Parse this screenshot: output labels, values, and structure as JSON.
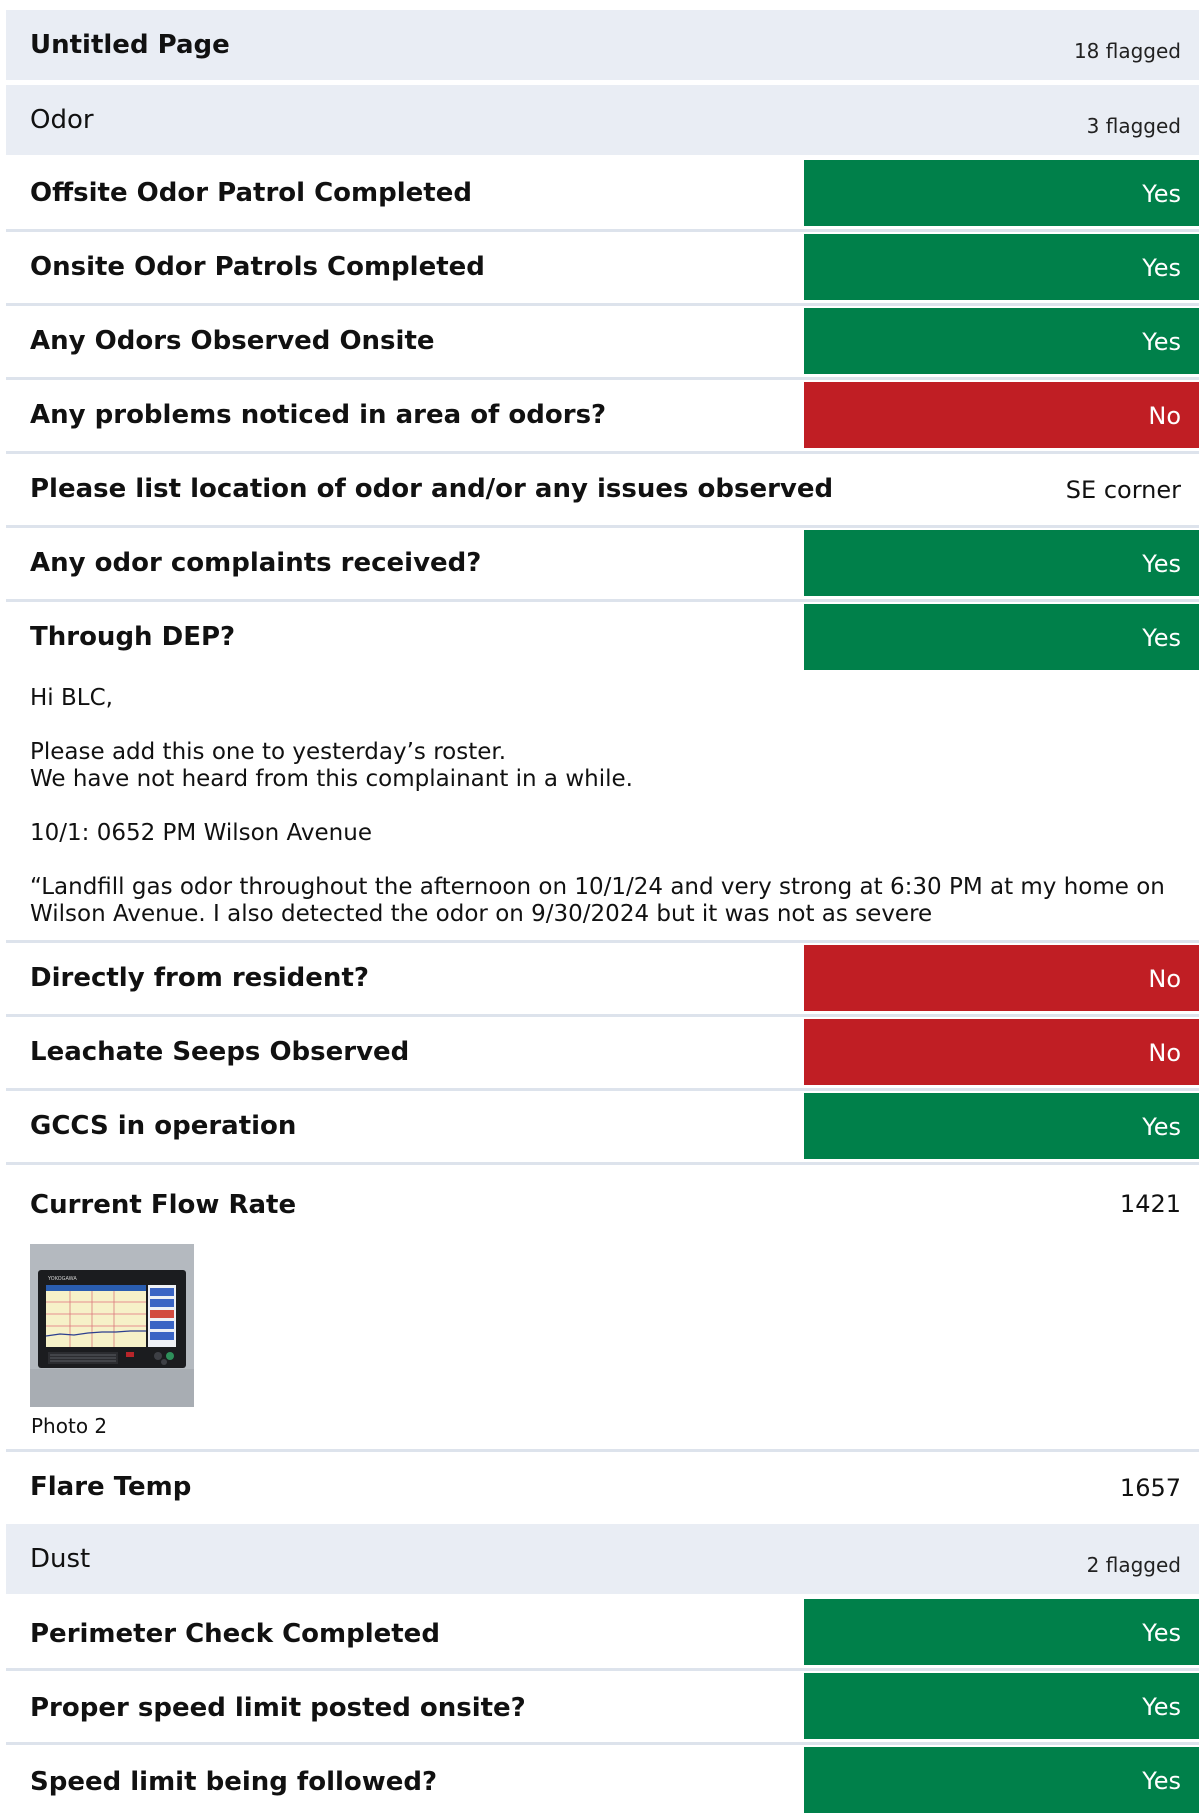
{
  "page": {
    "title": "Untitled Page",
    "flagged": "18 flagged"
  },
  "sections": {
    "odor": {
      "title": "Odor",
      "flagged": "3 flagged"
    },
    "dust": {
      "title": "Dust",
      "flagged": "2 flagged"
    }
  },
  "colors": {
    "yes": "#00804a",
    "no": "#c01e24",
    "band": "#e9edf4"
  },
  "odor_items": {
    "offsite_patrol": {
      "label": "Offsite Odor Patrol Completed",
      "answer": "Yes"
    },
    "onsite_patrols": {
      "label": "Onsite Odor Patrols Completed",
      "answer": "Yes"
    },
    "odors_observed": {
      "label": "Any Odors Observed Onsite",
      "answer": "Yes"
    },
    "problems_noticed": {
      "label": "Any problems noticed in area of odors?",
      "answer": "No"
    },
    "odor_location": {
      "label": "Please list location of odor and/or any issues observed",
      "value": "SE corner"
    },
    "complaints": {
      "label": "Any odor complaints received?",
      "answer": "Yes"
    },
    "through_dep": {
      "label": "Through DEP?",
      "answer": "Yes"
    },
    "note": {
      "greeting": "Hi BLC,",
      "line1": "Please add this one to yesterday’s roster.",
      "line2": "We have not heard from this complainant in a while.",
      "line3": "10/1: 0652 PM Wilson Avenue",
      "line4": "“Landfill gas odor throughout the afternoon on 10/1/24 and very strong at 6:30 PM at my home on Wilson Avenue. I also detected the odor on 9/30/2024 but it was not as severe"
    },
    "from_resident": {
      "label": "Directly from resident?",
      "answer": "No"
    },
    "leachate": {
      "label": "Leachate Seeps Observed",
      "answer": "No"
    },
    "gccs": {
      "label": "GCCS in operation",
      "answer": "Yes"
    },
    "flow_rate": {
      "label": "Current Flow Rate",
      "value": "1421"
    },
    "photo": {
      "caption": "Photo 2",
      "device_brand": "YOKOGAWA"
    },
    "flare_temp": {
      "label": "Flare Temp",
      "value": "1657"
    }
  },
  "dust_items": {
    "perimeter": {
      "label": "Perimeter Check Completed",
      "answer": "Yes"
    },
    "speed_posted": {
      "label": "Proper speed limit posted onsite?",
      "answer": "Yes"
    },
    "speed_followed": {
      "label": "Speed limit being followed?",
      "answer": "Yes"
    }
  }
}
